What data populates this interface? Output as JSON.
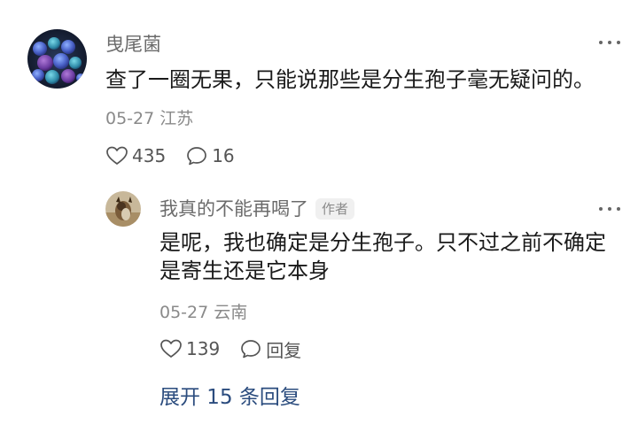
{
  "comment": {
    "username": "曳尾菌",
    "text": "查了一圈无果，只能说那些是分生孢子毫无疑问的。",
    "date": "05-27",
    "location": "江苏",
    "likes": "435",
    "replies": "16",
    "avatar_icon": "mushroom-avatar",
    "more_icon": "more-horizontal-icon"
  },
  "reply": {
    "username": "我真的不能再喝了",
    "badge": "作者",
    "text": "是呢，我也确定是分生孢子。只不过之前不确定是寄生还是它本身",
    "date": "05-27",
    "location": "云南",
    "likes": "139",
    "reply_label": "回复",
    "avatar_icon": "dog-avatar"
  },
  "expand_label": "展开 15 条回复",
  "colors": {
    "text": "#1a1a1a",
    "muted": "#8a8a8a",
    "username": "#6b6b6b",
    "link": "#2b4c7e"
  }
}
